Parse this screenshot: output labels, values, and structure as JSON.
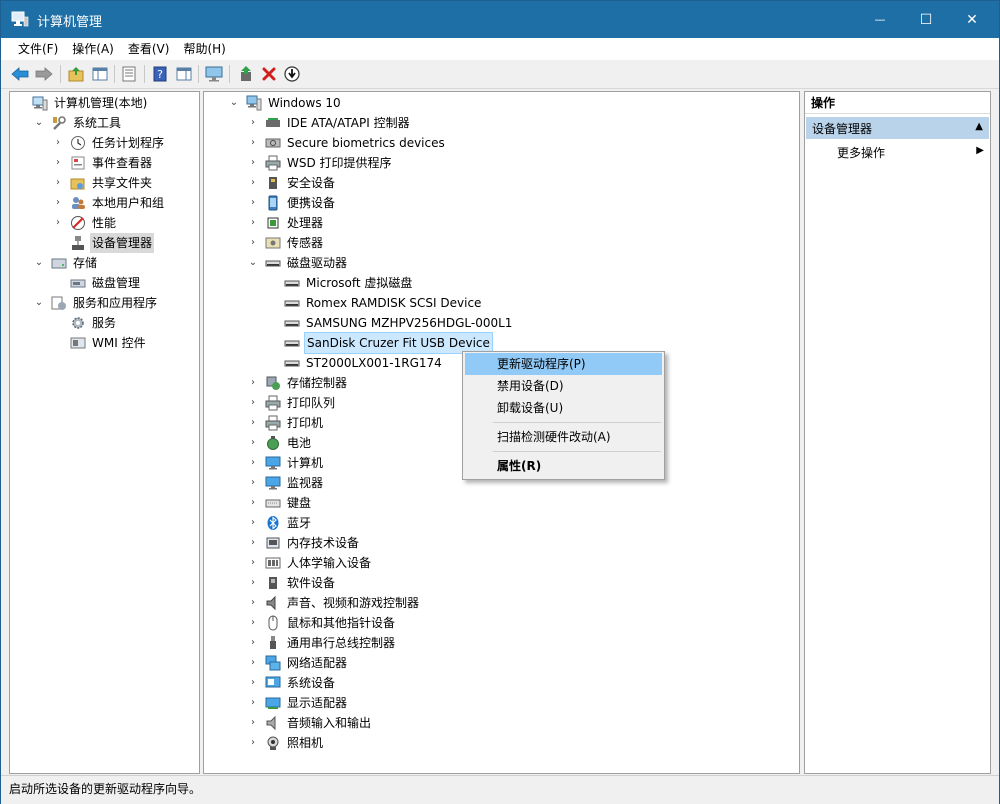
{
  "window": {
    "title": "计算机管理",
    "minimize": "—",
    "maximize": "☐",
    "close": "✕"
  },
  "menu": [
    "文件(F)",
    "操作(A)",
    "查看(V)",
    "帮助(H)"
  ],
  "left_tree": [
    {
      "label": "计算机管理(本地)",
      "level": 0,
      "arrow": "",
      "icon": "computer-management-icon"
    },
    {
      "label": "系统工具",
      "level": 1,
      "arrow": "⌄",
      "icon": "tools-icon"
    },
    {
      "label": "任务计划程序",
      "level": 2,
      "arrow": "›",
      "icon": "clock-icon"
    },
    {
      "label": "事件查看器",
      "level": 2,
      "arrow": "›",
      "icon": "event-viewer-icon"
    },
    {
      "label": "共享文件夹",
      "level": 2,
      "arrow": "›",
      "icon": "shared-folder-icon"
    },
    {
      "label": "本地用户和组",
      "level": 2,
      "arrow": "›",
      "icon": "users-icon"
    },
    {
      "label": "性能",
      "level": 2,
      "arrow": "›",
      "icon": "performance-icon"
    },
    {
      "label": "设备管理器",
      "level": 2,
      "arrow": "",
      "icon": "device-manager-icon",
      "selected": true
    },
    {
      "label": "存储",
      "level": 1,
      "arrow": "⌄",
      "icon": "storage-icon"
    },
    {
      "label": "磁盘管理",
      "level": 2,
      "arrow": "",
      "icon": "disk-management-icon"
    },
    {
      "label": "服务和应用程序",
      "level": 1,
      "arrow": "⌄",
      "icon": "services-apps-icon"
    },
    {
      "label": "服务",
      "level": 2,
      "arrow": "",
      "icon": "gear-icon"
    },
    {
      "label": "WMI 控件",
      "level": 2,
      "arrow": "",
      "icon": "wmi-icon"
    }
  ],
  "device_tree": [
    {
      "label": "Windows 10",
      "level": 0,
      "arrow": "⌄",
      "icon": "computer-icon"
    },
    {
      "label": "IDE ATA/ATAPI 控制器",
      "level": 1,
      "arrow": "›",
      "icon": "ide-icon"
    },
    {
      "label": "Secure biometrics devices",
      "level": 1,
      "arrow": "›",
      "icon": "biometric-icon"
    },
    {
      "label": "WSD 打印提供程序",
      "level": 1,
      "arrow": "›",
      "icon": "printer-icon"
    },
    {
      "label": "安全设备",
      "level": 1,
      "arrow": "›",
      "icon": "security-icon"
    },
    {
      "label": "便携设备",
      "level": 1,
      "arrow": "›",
      "icon": "portable-icon"
    },
    {
      "label": "处理器",
      "level": 1,
      "arrow": "›",
      "icon": "cpu-icon"
    },
    {
      "label": "传感器",
      "level": 1,
      "arrow": "›",
      "icon": "sensor-icon"
    },
    {
      "label": "磁盘驱动器",
      "level": 1,
      "arrow": "⌄",
      "icon": "disk-icon"
    },
    {
      "label": "Microsoft 虚拟磁盘",
      "level": 2,
      "arrow": "",
      "icon": "disk-icon"
    },
    {
      "label": "Romex RAMDISK SCSI Device",
      "level": 2,
      "arrow": "",
      "icon": "disk-icon"
    },
    {
      "label": "SAMSUNG MZHPV256HDGL-000L1",
      "level": 2,
      "arrow": "",
      "icon": "disk-icon"
    },
    {
      "label": "SanDisk Cruzer Fit USB Device",
      "level": 2,
      "arrow": "",
      "icon": "disk-icon",
      "selected": true
    },
    {
      "label": "ST2000LX001-1RG174",
      "level": 2,
      "arrow": "",
      "icon": "disk-icon"
    },
    {
      "label": "存储控制器",
      "level": 1,
      "arrow": "›",
      "icon": "storage-controller-icon"
    },
    {
      "label": "打印队列",
      "level": 1,
      "arrow": "›",
      "icon": "printer-icon"
    },
    {
      "label": "打印机",
      "level": 1,
      "arrow": "›",
      "icon": "printer-icon"
    },
    {
      "label": "电池",
      "level": 1,
      "arrow": "›",
      "icon": "battery-icon"
    },
    {
      "label": "计算机",
      "level": 1,
      "arrow": "›",
      "icon": "monitor-icon"
    },
    {
      "label": "监视器",
      "level": 1,
      "arrow": "›",
      "icon": "monitor-icon"
    },
    {
      "label": "键盘",
      "level": 1,
      "arrow": "›",
      "icon": "keyboard-icon"
    },
    {
      "label": "蓝牙",
      "level": 1,
      "arrow": "›",
      "icon": "bluetooth-icon"
    },
    {
      "label": "内存技术设备",
      "level": 1,
      "arrow": "›",
      "icon": "memory-icon"
    },
    {
      "label": "人体学输入设备",
      "level": 1,
      "arrow": "›",
      "icon": "hid-icon"
    },
    {
      "label": "软件设备",
      "level": 1,
      "arrow": "›",
      "icon": "software-device-icon"
    },
    {
      "label": "声音、视频和游戏控制器",
      "level": 1,
      "arrow": "›",
      "icon": "speaker-icon"
    },
    {
      "label": "鼠标和其他指针设备",
      "level": 1,
      "arrow": "›",
      "icon": "mouse-icon"
    },
    {
      "label": "通用串行总线控制器",
      "level": 1,
      "arrow": "›",
      "icon": "usb-icon"
    },
    {
      "label": "网络适配器",
      "level": 1,
      "arrow": "›",
      "icon": "network-icon"
    },
    {
      "label": "系统设备",
      "level": 1,
      "arrow": "›",
      "icon": "system-device-icon"
    },
    {
      "label": "显示适配器",
      "level": 1,
      "arrow": "›",
      "icon": "display-adapter-icon"
    },
    {
      "label": "音频输入和输出",
      "level": 1,
      "arrow": "›",
      "icon": "audio-icon"
    },
    {
      "label": "照相机",
      "level": 1,
      "arrow": "›",
      "icon": "camera-icon"
    }
  ],
  "context_menu": [
    {
      "label": "更新驱动程序(P)",
      "highlight": true
    },
    {
      "label": "禁用设备(D)"
    },
    {
      "label": "卸载设备(U)"
    },
    {
      "sep": true
    },
    {
      "label": "扫描检测硬件改动(A)"
    },
    {
      "sep": true
    },
    {
      "label": "属性(R)",
      "bold": true
    }
  ],
  "actions": {
    "header": "操作",
    "section": "设备管理器",
    "section_arrow": "▲",
    "more": "更多操作",
    "more_arrow": "▶"
  },
  "status": "启动所选设备的更新驱动程序向导。",
  "colors": {
    "titlebar": "#1e6fa6",
    "selection": "#cce8ff",
    "menu_highlight": "#91c9f7",
    "action_section": "#b9d3ea"
  }
}
